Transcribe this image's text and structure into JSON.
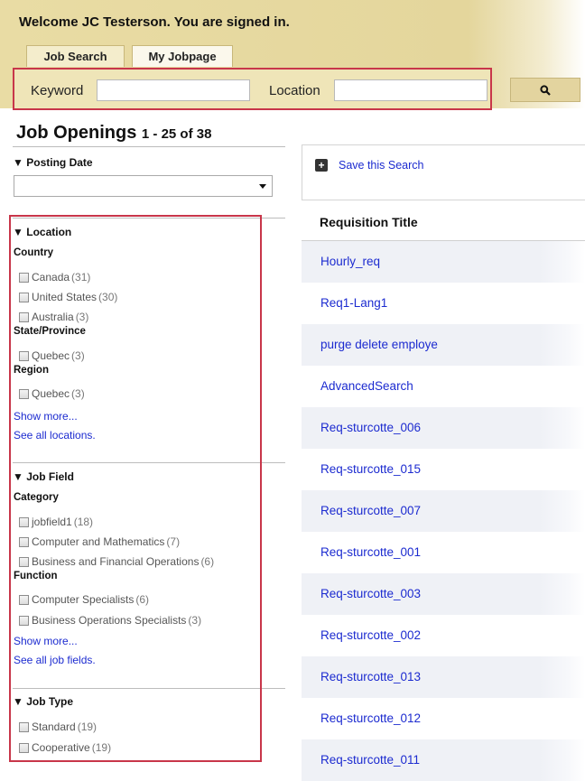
{
  "header": {
    "welcome": "Welcome JC Testerson. You are signed in.",
    "tabs": [
      "Job Search",
      "My Jobpage"
    ]
  },
  "search": {
    "keyword_label": "Keyword",
    "keyword_value": "",
    "location_label": "Location",
    "location_value": "",
    "button_icon": "magnifier-icon"
  },
  "results": {
    "title": "Job Openings",
    "count": "1 - 25 of 38",
    "save_search": "Save this Search",
    "column_header": "Requisition Title",
    "rows": [
      "Hourly_req",
      "Req1-Lang1",
      "purge delete employe",
      "AdvancedSearch",
      "Req-sturcotte_006",
      "Req-sturcotte_015",
      "Req-sturcotte_007",
      "Req-sturcotte_001",
      "Req-sturcotte_003",
      "Req-sturcotte_002",
      "Req-sturcotte_013",
      "Req-sturcotte_012",
      "Req-sturcotte_011"
    ]
  },
  "facets": {
    "posting_date": {
      "label": "Posting Date",
      "selected": ""
    },
    "location": {
      "label": "Location",
      "country_label": "Country",
      "countries": [
        {
          "name": "Canada",
          "count": "(31)"
        },
        {
          "name": "United States",
          "count": "(30)"
        },
        {
          "name": "Australia",
          "count": "(3)"
        }
      ],
      "state_label": "State/Province",
      "states": [
        {
          "name": "Quebec",
          "count": "(3)"
        }
      ],
      "region_label": "Region",
      "regions": [
        {
          "name": "Quebec",
          "count": "(3)"
        }
      ],
      "show_more": "Show more...",
      "see_all": "See all locations."
    },
    "job_field": {
      "label": "Job Field",
      "category_label": "Category",
      "categories": [
        {
          "name": "jobfield1",
          "count": "(18)"
        },
        {
          "name": "Computer and Mathematics",
          "count": "(7)"
        },
        {
          "name": "Business and Financial Operations",
          "count": "(6)"
        }
      ],
      "function_label": "Function",
      "functions": [
        {
          "name": "Computer Specialists",
          "count": "(6)"
        },
        {
          "name": "Business Operations Specialists",
          "count": "(3)"
        }
      ],
      "show_more": "Show more...",
      "see_all": "See all job fields."
    },
    "job_type": {
      "label": "Job Type",
      "types": [
        {
          "name": "Standard",
          "count": "(19)"
        },
        {
          "name": "Cooperative",
          "count": "(19)"
        }
      ]
    }
  },
  "colors": {
    "accent_red": "#c8364a",
    "link_blue": "#1c2bd0",
    "header_tan": "#e9dca4"
  }
}
